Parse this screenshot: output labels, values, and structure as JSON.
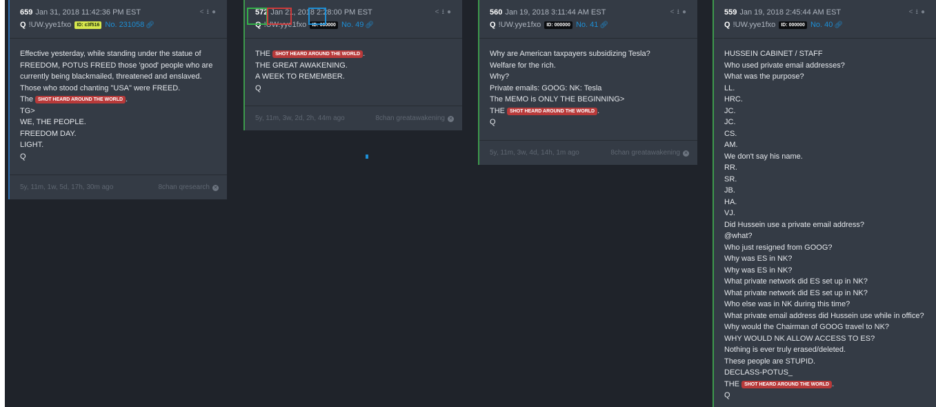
{
  "posts": [
    {
      "num": "659",
      "datetime": "Jan 31, 2018 11:42:36 PM EST",
      "author": "Q",
      "trip": "!UW.yye1fxo",
      "id_badge": "ID: c3f516",
      "post_no": "No. 231058",
      "body": [
        "Effective yesterday, while standing under the statue of",
        "FREEDOM, POTUS FREED those 'good' people who are",
        "currently being blackmailed, threatened and enslaved.",
        "Those who stood chanting \"USA\" were FREED."
      ],
      "shot_prefix": "The",
      "shot_suffix": ".",
      "body2": [
        "TG>",
        "WE, THE PEOPLE.",
        "FREEDOM DAY.",
        "LIGHT.",
        "Q"
      ],
      "ago": "5y, 11m, 1w, 5d, 17h, 30m ago",
      "source": "8chan qresearch"
    },
    {
      "num": "572",
      "date_part": "Jan 21",
      "year_part": ", 2018",
      "time_part": "2:28",
      "time_rest": ":00 PM EST",
      "author": "Q",
      "trip": "!UW.yye1fxo",
      "id_badge": "ID: 000000",
      "post_no": "No. 49",
      "shot_prefix": "THE",
      "shot_suffix": ".",
      "body": [
        "THE GREAT AWAKENING.",
        "A WEEK TO REMEMBER.",
        "Q"
      ],
      "ago": "5y, 11m, 3w, 2d, 2h, 44m ago",
      "source": "8chan greatawakening"
    },
    {
      "num": "560",
      "datetime": "Jan 19, 2018 3:11:44 AM EST",
      "author": "Q",
      "trip": "!UW.yye1fxo",
      "id_badge": "ID: 000000",
      "post_no": "No. 41",
      "body": [
        "Why are American taxpayers subsidizing Tesla?",
        "Welfare for the rich.",
        "Why?",
        "Private emails: GOOG: NK: Tesla",
        "The MEMO is ONLY THE BEGINNING>"
      ],
      "shot_prefix": "THE",
      "shot_suffix": ".",
      "body2": [
        "Q"
      ],
      "ago": "5y, 11m, 3w, 4d, 14h, 1m ago",
      "source": "8chan greatawakening"
    },
    {
      "num": "559",
      "datetime": "Jan 19, 2018 2:45:44 AM EST",
      "author": "Q",
      "trip": "!UW.yye1fxo",
      "id_badge": "ID: 000000",
      "post_no": "No. 40",
      "body": [
        "HUSSEIN CABINET / STAFF",
        "Who used private email addresses?",
        "What was the purpose?",
        "LL.",
        "HRC.",
        "JC.",
        "JC.",
        "CS.",
        "AM.",
        "We don't say his name.",
        "RR.",
        "SR.",
        "JB.",
        "HA.",
        "VJ.",
        "Did Hussein use a private email address?",
        "@what?",
        "Who just resigned from GOOG?",
        "Why was ES in NK?",
        "Why was ES in NK?",
        "What private network did ES set up in NK?",
        "What private network did ES set up in NK?",
        "Who else was in NK during this time?",
        "What private email address did Hussein use while in office?",
        "Why would the Chairman of GOOG travel to NK?",
        "WHY WOULD NK ALLOW ACCESS TO ES?",
        "Nothing is ever truly erased/deleted.",
        "These people are STUPID.",
        "DECLASS-POTUS_"
      ],
      "shot_prefix": "THE",
      "shot_suffix": ".",
      "body2": [
        "Q"
      ]
    }
  ],
  "shot_badge": "SHOT HEARD AROUND THE WORLD",
  "colors": {
    "background": "#1f232a",
    "card": "#343b45",
    "accent_green": "#3d9a4c",
    "accent_blue": "#2f6fb0",
    "link": "#1d8fd6",
    "badge_red": "#b83a3a"
  },
  "icons": [
    "share-icon",
    "download-icon",
    "arrow-circle-icon",
    "link-icon",
    "close-circle-icon"
  ]
}
